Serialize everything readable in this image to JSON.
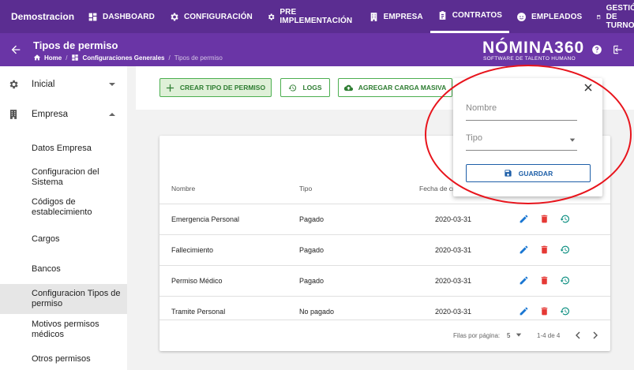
{
  "topnav": {
    "brand": "Demostracion",
    "items": [
      {
        "label": "DASHBOARD",
        "icon": "dashboard-icon"
      },
      {
        "label": "CONFIGURACIÓN",
        "icon": "gear-icon"
      },
      {
        "label": "PRE IMPLEMENTACIÓN",
        "icon": "gear-icon"
      },
      {
        "label": "EMPRESA",
        "icon": "building-icon"
      },
      {
        "label": "CONTRATOS",
        "icon": "clipboard-icon"
      },
      {
        "label": "EMPLEADOS",
        "icon": "face-icon"
      },
      {
        "label": "GESTIÓN DE TURNOS",
        "icon": "calendar-icon"
      }
    ]
  },
  "subheader": {
    "title": "Tipos de permiso",
    "breadcrumb": [
      "Home",
      "Configuraciones Generales",
      "Tipos de permiso"
    ],
    "logo": "NÓMINA360",
    "logo_sub": "SOFTWARE DE TALENTO HUMANO"
  },
  "sidebar": {
    "sections": [
      {
        "label": "Inicial",
        "icon": "gear-icon"
      },
      {
        "label": "Empresa",
        "icon": "building-icon"
      }
    ],
    "items": [
      "Datos Empresa",
      "Configuracion del Sistema",
      "Códigos de establecimiento",
      "Cargos",
      "Bancos",
      "Configuracion Tipos de permiso",
      "Motivos permisos médicos",
      "Otros permisos"
    ]
  },
  "toolbar": {
    "create": "CREAR TIPO DE PERMISO",
    "logs": "LOGS",
    "bulk": "AGREGAR CARGA MASIVA"
  },
  "table": {
    "headers": [
      "Nombre",
      "Tipo",
      "Fecha de cre"
    ],
    "rows": [
      {
        "nombre": "Emergencia Personal",
        "tipo": "Pagado",
        "fecha": "2020-03-31"
      },
      {
        "nombre": "Fallecimiento",
        "tipo": "Pagado",
        "fecha": "2020-03-31"
      },
      {
        "nombre": "Permiso Médico",
        "tipo": "Pagado",
        "fecha": "2020-03-31"
      },
      {
        "nombre": "Tramite Personal",
        "tipo": "No pagado",
        "fecha": "2020-03-31"
      }
    ],
    "footer": {
      "rows_label": "Filas por página:",
      "rows_value": "5",
      "range": "1-4 de 4"
    }
  },
  "form": {
    "nombre_placeholder": "Nombre",
    "tipo_placeholder": "Tipo",
    "save": "GUARDAR"
  },
  "colors": {
    "nav": "#5b2d91",
    "subnav": "#6a35a6",
    "accent_green": "#4caf50",
    "edit_blue": "#1976d2",
    "delete_red": "#e53935",
    "history_teal": "#00897b",
    "annotation_red": "#e8141c"
  }
}
